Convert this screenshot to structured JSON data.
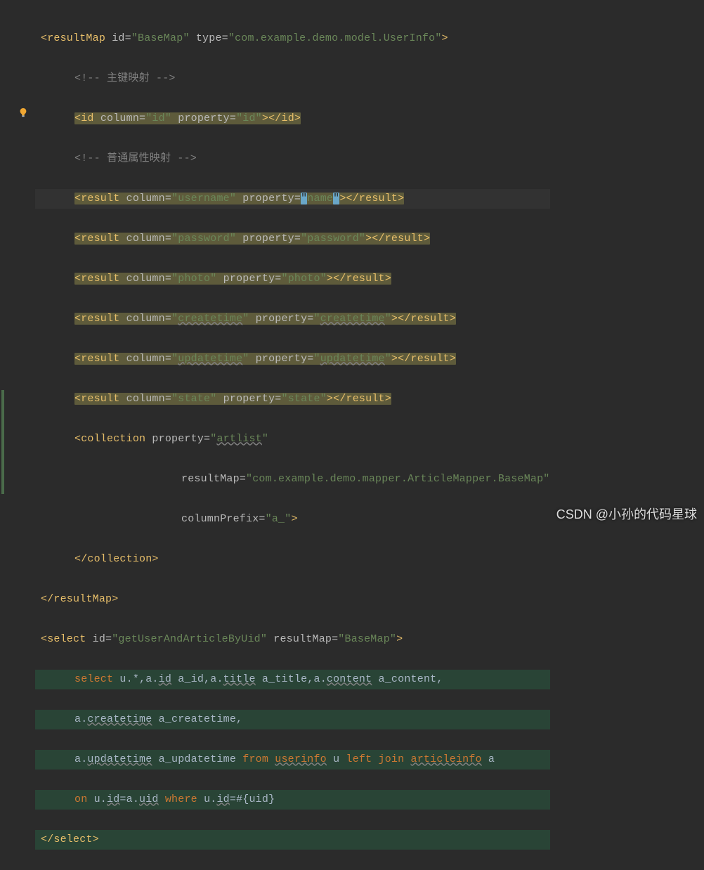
{
  "editor": {
    "watermark": "CSDN @小孙的代码星球",
    "lines": {
      "l1_open": "<",
      "l1_tag": "resultMap ",
      "l1_attr_id": "id",
      "l1_eq": "=",
      "l1_val_id": "\"BaseMap\"",
      "l1_attr_type": " type",
      "l1_val_type": "\"com.example.demo.model.UserInfo\"",
      "l1_close": ">",
      "l2_comment": "<!-- 主键映射 -->",
      "l3_open": "<",
      "l3_tag": "id ",
      "l3_attr_col": "column",
      "l3_val_col": "\"id\"",
      "l3_attr_prop": " property",
      "l3_val_prop": "\"id\"",
      "l3_close": "></",
      "l3_tag2": "id",
      "l3_end": ">",
      "l4_comment": "<!-- 普通属性映射 -->",
      "r_open": "<",
      "r_tag": "result ",
      "r_attr_col": "column",
      "r_eq": "=",
      "r_close_open": "></",
      "r_tag_end": "result",
      "r_end": ">",
      "r5_col": "\"username\"",
      "r5_prop_attr": " property",
      "r5_prop_q1": "\"",
      "r5_prop_val": "name",
      "r5_prop_q2": "\"",
      "r6_col": "\"password\"",
      "r6_prop": "\"password\"",
      "r7_col": "\"photo\"",
      "r7_prop": "\"photo\"",
      "r8_col": "createtime",
      "r8_prop": "createtime",
      "r9_col": "updatetime",
      "r9_prop": "updatetime",
      "r10_col": "\"state\"",
      "r10_prop": "\"state\"",
      "prop_attr": " property",
      "coll_open": "<",
      "coll_tag": "collection ",
      "coll_prop_attr": "property",
      "coll_prop_val_q": "\"",
      "coll_prop_val": "artlist",
      "coll_rm_attr": "resultMap",
      "coll_rm_val": "\"com.example.demo.mapper.ArticleMapper.BaseMap\"",
      "coll_cp_attr": "columnPrefix",
      "coll_cp_val": "\"a_\"",
      "coll_close": ">",
      "coll_end_open": "</",
      "coll_end_tag": "collection",
      "coll_end": ">",
      "rm_end_open": "</",
      "rm_end_tag": "resultMap",
      "rm_end": ">",
      "sel_open": "<",
      "sel_tag": "select ",
      "sel_id_attr": "id",
      "sel_id_val": "\"getUserAndArticleByUid\"",
      "sel_rm_attr": " resultMap",
      "sel_rm_val": "\"BaseMap\"",
      "sel_close": ">",
      "sql1_select": "select ",
      "sql1_u": "u.*,a.",
      "sql1_id": "id",
      "sql1_aid": " a_id,a.",
      "sql1_title": "title",
      "sql1_atitle": " a_title,a.",
      "sql1_content": "content",
      "sql1_acontent": " a_content,",
      "sql2_a": "a.",
      "sql2_ct": "createtime",
      "sql2_act": " a_createtime,",
      "sql3_a": "a.",
      "sql3_ut": "updatetime",
      "sql3_aut": " a_updatetime ",
      "sql3_from": "from ",
      "sql3_ui": "userinfo",
      "sql3_u": " u ",
      "sql3_lj": "left join ",
      "sql3_ai": "articleinfo",
      "sql3_a2": " a",
      "sql4_on": "on ",
      "sql4_uid": "u.",
      "sql4_id1": "id",
      "sql4_eq": "=a.",
      "sql4_uid2": "uid",
      "sql4_where": " where ",
      "sql4_uid3": "u.",
      "sql4_id2": "id",
      "sql4_param": "=#{uid}",
      "sel_end_open": "</",
      "sel_end_tag": "select",
      "sel_end": ">"
    }
  }
}
